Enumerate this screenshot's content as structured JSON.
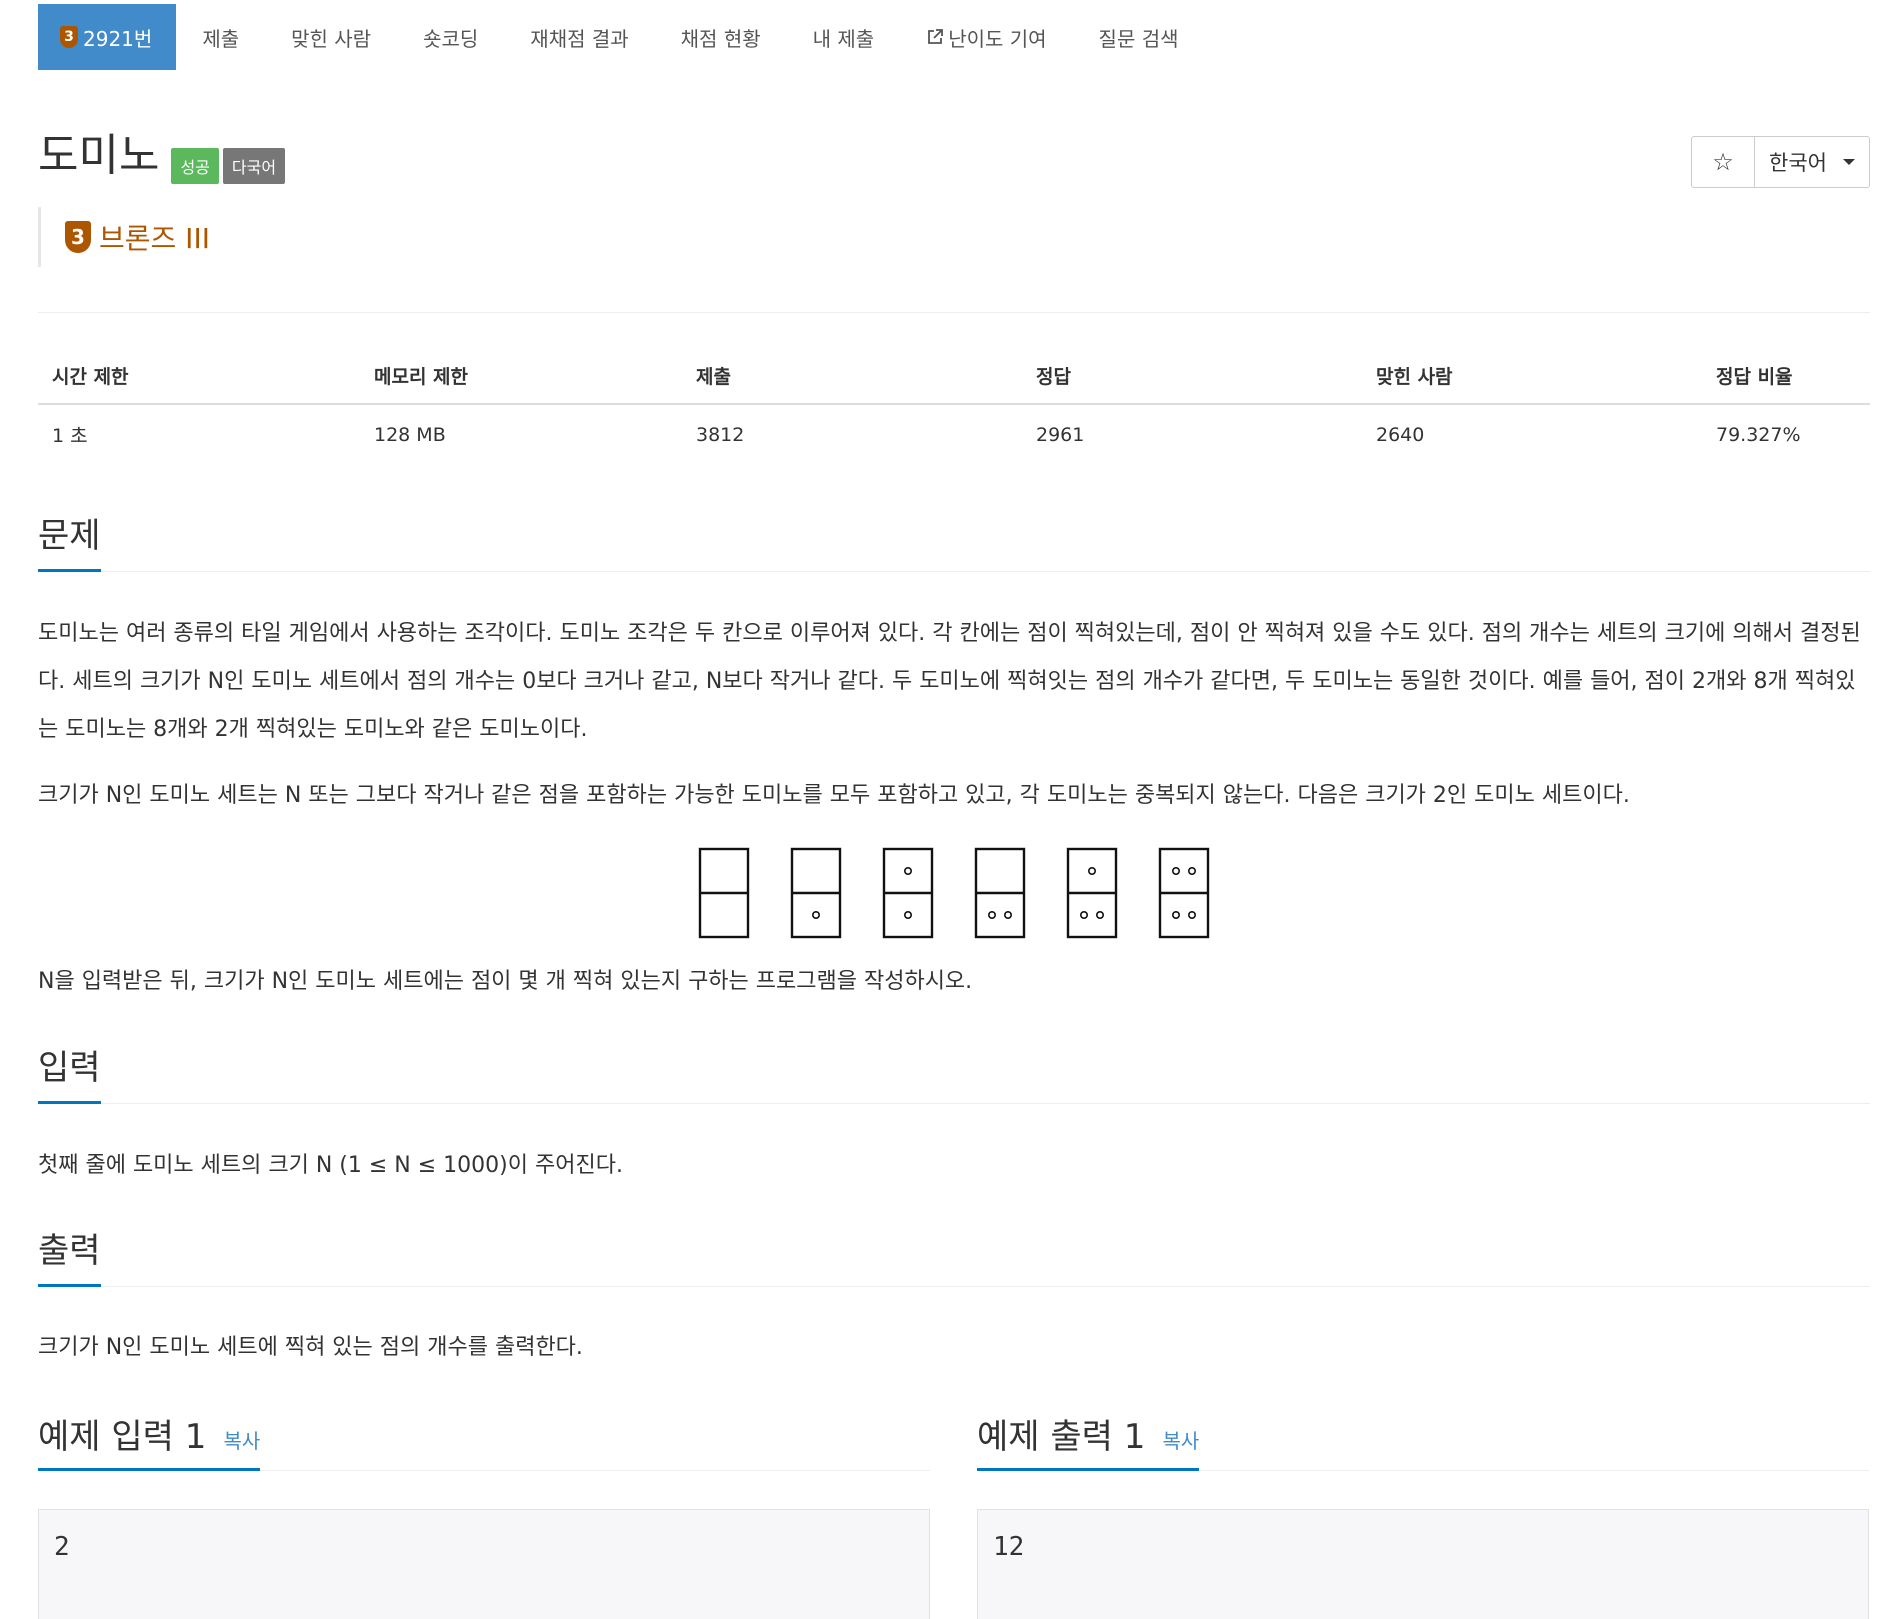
{
  "tabs": [
    {
      "label": "2921번",
      "badge": "3",
      "active": true
    },
    {
      "label": "제출"
    },
    {
      "label": "맞힌 사람"
    },
    {
      "label": "숏코딩"
    },
    {
      "label": "재채점 결과"
    },
    {
      "label": "채점 현황"
    },
    {
      "label": "내 제출"
    },
    {
      "label": "난이도 기여",
      "icon": "external-link-icon"
    },
    {
      "label": "질문 검색"
    }
  ],
  "problem": {
    "title": "도미노",
    "labels": {
      "success": "성공",
      "multilang": "다국어"
    },
    "tier": {
      "badge": "3",
      "text": "브론즈 III",
      "color": "#ad5600"
    }
  },
  "actions": {
    "star": "☆",
    "language": "한국어"
  },
  "stats": {
    "headers": [
      "시간 제한",
      "메모리 제한",
      "제출",
      "정답",
      "맞힌 사람",
      "정답 비율"
    ],
    "values": [
      "1 초",
      "128 MB",
      "3812",
      "2961",
      "2640",
      "79.327%"
    ]
  },
  "sections": {
    "problem": {
      "heading": "문제",
      "p1": "도미노는 여러 종류의 타일 게임에서 사용하는 조각이다. 도미노 조각은 두 칸으로 이루어져 있다. 각 칸에는 점이 찍혀있는데, 점이 안 찍혀져 있을 수도 있다. 점의 개수는 세트의 크기에 의해서 결정된다. 세트의 크기가 N인 도미노 세트에서 점의 개수는 0보다 크거나 같고, N보다 작거나 같다. 두 도미노에 찍혀잇는 점의 개수가 같다면, 두 도미노는 동일한 것이다. 예를 들어, 점이 2개와 8개 찍혀있는 도미노는 8개와 2개 찍혀있는 도미노와 같은 도미노이다.",
      "p2": "크기가 N인 도미노 세트는 N 또는 그보다 작거나 같은 점을 포함하는 가능한 도미노를 모두 포함하고 있고, 각 도미노는 중복되지 않는다. 다음은 크기가 2인 도미노 세트이다.",
      "p3": "N을 입력받은 뒤, 크기가 N인 도미노 세트에는 점이 몇 개 찍혀 있는지 구하는 프로그램을 작성하시오."
    },
    "input": {
      "heading": "입력",
      "text": "첫째 줄에 도미노 세트의 크기 N (1 ≤ N ≤ 1000)이 주어진다."
    },
    "output": {
      "heading": "출력",
      "text": "크기가 N인 도미노 세트에 찍혀 있는 점의 개수를 출력한다."
    }
  },
  "dominoes": [
    [
      0,
      0
    ],
    [
      0,
      1
    ],
    [
      1,
      1
    ],
    [
      0,
      2
    ],
    [
      1,
      2
    ],
    [
      2,
      2
    ]
  ],
  "samples": {
    "input": {
      "heading": "예제 입력 1",
      "copy": "복사",
      "value": "2"
    },
    "output": {
      "heading": "예제 출력 1",
      "copy": "복사",
      "value": "12"
    }
  },
  "colors": {
    "accent": "#428bca",
    "underline": "#0076c0",
    "success": "#5cb85c",
    "multilang": "#777777",
    "bronze": "#ad5600"
  }
}
